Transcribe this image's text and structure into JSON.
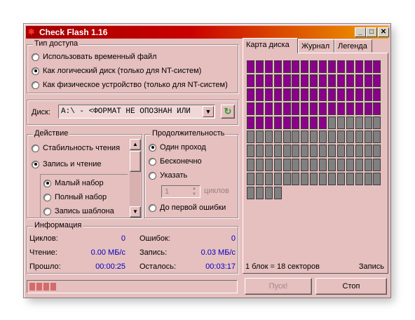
{
  "window": {
    "title": "Check Flash 1.16",
    "min": "_",
    "max": "□",
    "close": "✕"
  },
  "access": {
    "label": "Тип доступа",
    "options": [
      {
        "label": "Использовать временный файл",
        "selected": false
      },
      {
        "label": "Как логический диск (только для NT-систем)",
        "selected": true
      },
      {
        "label": "Как физическое устройство (только для NT-систем)",
        "selected": false
      }
    ]
  },
  "disk": {
    "label": "Диск:",
    "value": "A:\\ - <ФОРМАТ НЕ ОПОЗНАН ИЛИ",
    "dropdown_icon": "chevron-down",
    "refresh_icon": "refresh"
  },
  "action": {
    "label": "Действие",
    "options": [
      {
        "label": "Стабильность чтения",
        "selected": false
      },
      {
        "label": "Запись и чтение",
        "selected": true
      }
    ],
    "sub": [
      {
        "label": "Малый набор",
        "selected": true
      },
      {
        "label": "Полный набор",
        "selected": false
      },
      {
        "label": "Запись шаблона",
        "selected": false
      }
    ]
  },
  "duration": {
    "label": "Продолжительность",
    "options": [
      {
        "label": "Один проход",
        "selected": true
      },
      {
        "label": "Бесконечно",
        "selected": false
      },
      {
        "label": "Указать",
        "selected": false
      },
      {
        "label": "До первой ошибки",
        "selected": false
      }
    ],
    "cycles_value": "1",
    "cycles_label": "циклов"
  },
  "info": {
    "label": "Информация",
    "cycles_label": "Циклов:",
    "cycles_value": "0",
    "errors_label": "Ошибок:",
    "errors_value": "0",
    "read_label": "Чтение:",
    "read_value": "0.00 МБ/с",
    "write_label": "Запись:",
    "write_value": "0.03 МБ/с",
    "elapsed_label": "Прошло:",
    "elapsed_value": "00:00:25",
    "remaining_label": "Осталось:",
    "remaining_value": "00:03:17"
  },
  "tabs": [
    {
      "label": "Карта диска",
      "active": true
    },
    {
      "label": "Журнал",
      "active": false
    },
    {
      "label": "Легенда",
      "active": false
    }
  ],
  "map": {
    "purple_blocks": 69,
    "gray_blocks": 70,
    "colors": {
      "written": "#8b008b",
      "pending": "#808080"
    }
  },
  "status": {
    "blocks": "1 блок = 18 секторов",
    "mode": "Запись"
  },
  "buttons": {
    "start": "Пуск!",
    "stop": "Стоп"
  },
  "progress": {
    "segments": 4
  },
  "colors": {
    "window_bg": "#e6bfbf",
    "value_text": "#0000c0",
    "accent_green": "#2a9a2a"
  }
}
